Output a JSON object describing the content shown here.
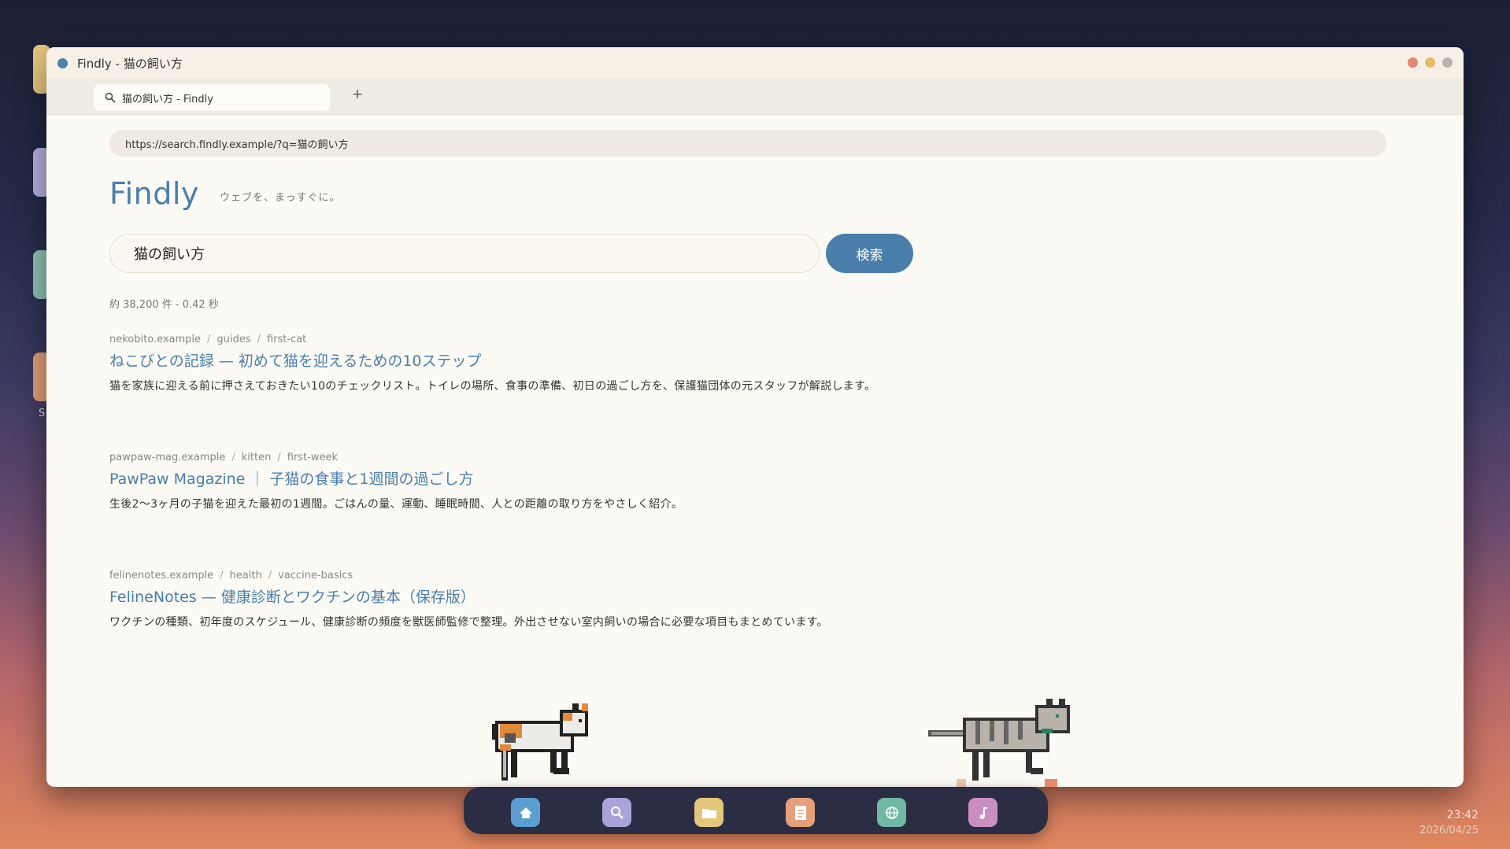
{
  "window": {
    "title": "Findly  -  猫の飼い方"
  },
  "tabs": [
    {
      "label": "猫の飼い方  -  Findly"
    }
  ],
  "new_tab_label": "+",
  "address_bar": {
    "url": "https://search.findly.example/?q=猫の飼い方"
  },
  "page": {
    "logo": "Findly",
    "tagline": "ウェブを、まっすぐに。",
    "search": {
      "value": "猫の飼い方",
      "button_label": "検索"
    },
    "stats": "約 38,200 件  -  0.42 秒",
    "results": [
      {
        "crumbs": [
          "nekobito.example",
          "guides",
          "first-cat"
        ],
        "title": "ねこびとの記録 — 初めて猫を迎えるための10ステップ",
        "snippet": "猫を家族に迎える前に押さえておきたい10のチェックリスト。トイレの場所、食事の準備、初日の過ごし方を、保護猫団体の元スタッフが解説します。"
      },
      {
        "crumbs": [
          "pawpaw-mag.example",
          "kitten",
          "first-week"
        ],
        "title": "PawPaw Magazine ｜ 子猫の食事と1週間の過ごし方",
        "snippet": "生後2〜3ヶ月の子猫を迎えた最初の1週間。ごはんの量、運動、睡眠時間、人との距離の取り方をやさしく紹介。"
      },
      {
        "crumbs": [
          "felinenotes.example",
          "health",
          "vaccine-basics"
        ],
        "title": "FelineNotes — 健康診断とワクチンの基本（保存版）",
        "snippet": "ワクチンの種類、初年度のスケジュール、健康診断の頻度を獣医師監修で整理。外出させない室内飼いの場合に必要な項目もまとめています。"
      }
    ]
  },
  "desktop": {
    "partial_label": "S"
  },
  "dock": {
    "items": [
      {
        "icon": "home-icon",
        "color": "#5b9fd0"
      },
      {
        "icon": "search-icon",
        "color": "#a9a3d8"
      },
      {
        "icon": "folder-icon",
        "color": "#e3c77a"
      },
      {
        "icon": "document-icon",
        "color": "#e3a07a"
      },
      {
        "icon": "globe-icon",
        "color": "#6fb8a5"
      },
      {
        "icon": "music-icon",
        "color": "#c98fc0"
      }
    ]
  },
  "clock": {
    "time": "23:42",
    "date": "2026/04/25"
  },
  "colors": {
    "accent": "#4a7fab",
    "window_bg": "#fcfaf5",
    "dock_bg": "#2b2d44"
  }
}
